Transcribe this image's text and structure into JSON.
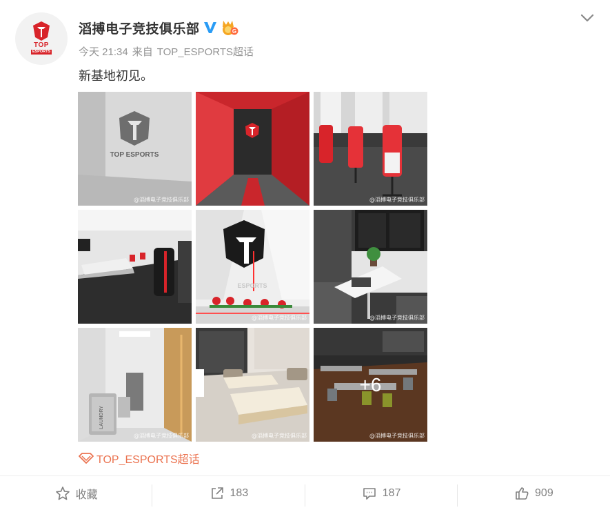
{
  "account": {
    "name": "滔搏电子竞技俱乐部",
    "avatar_logo_top": "TOP",
    "avatar_logo_sub": "ESPORTS"
  },
  "post": {
    "time": "今天 21:34",
    "source_prefix": "来自",
    "source": "TOP_ESPORTS超话",
    "text": "新基地初见。"
  },
  "images": {
    "watermark": "@滔搏电子竞技俱乐部",
    "more_count": "+6",
    "tiles": [
      {
        "name": "lobby-logo-wall",
        "logo_text": "TOP ESPORTS"
      },
      {
        "name": "red-corridor"
      },
      {
        "name": "gaming-chairs-room"
      },
      {
        "name": "reception-area"
      },
      {
        "name": "logo-entrance-wall",
        "logo_text": "ESPORTS"
      },
      {
        "name": "meeting-nook"
      },
      {
        "name": "laundry-hallway",
        "laundry_text": "LAUNDRY"
      },
      {
        "name": "bedroom"
      },
      {
        "name": "cafeteria"
      }
    ]
  },
  "topic": {
    "label": "TOP_ESPORTS超话",
    "color": "#eb7350"
  },
  "actions": {
    "favorite": "收藏",
    "repost": "183",
    "comment": "187",
    "like": "909"
  },
  "colors": {
    "brand_red": "#d8242a",
    "verified": "#2a9cf5",
    "meta_gray": "#939393"
  }
}
